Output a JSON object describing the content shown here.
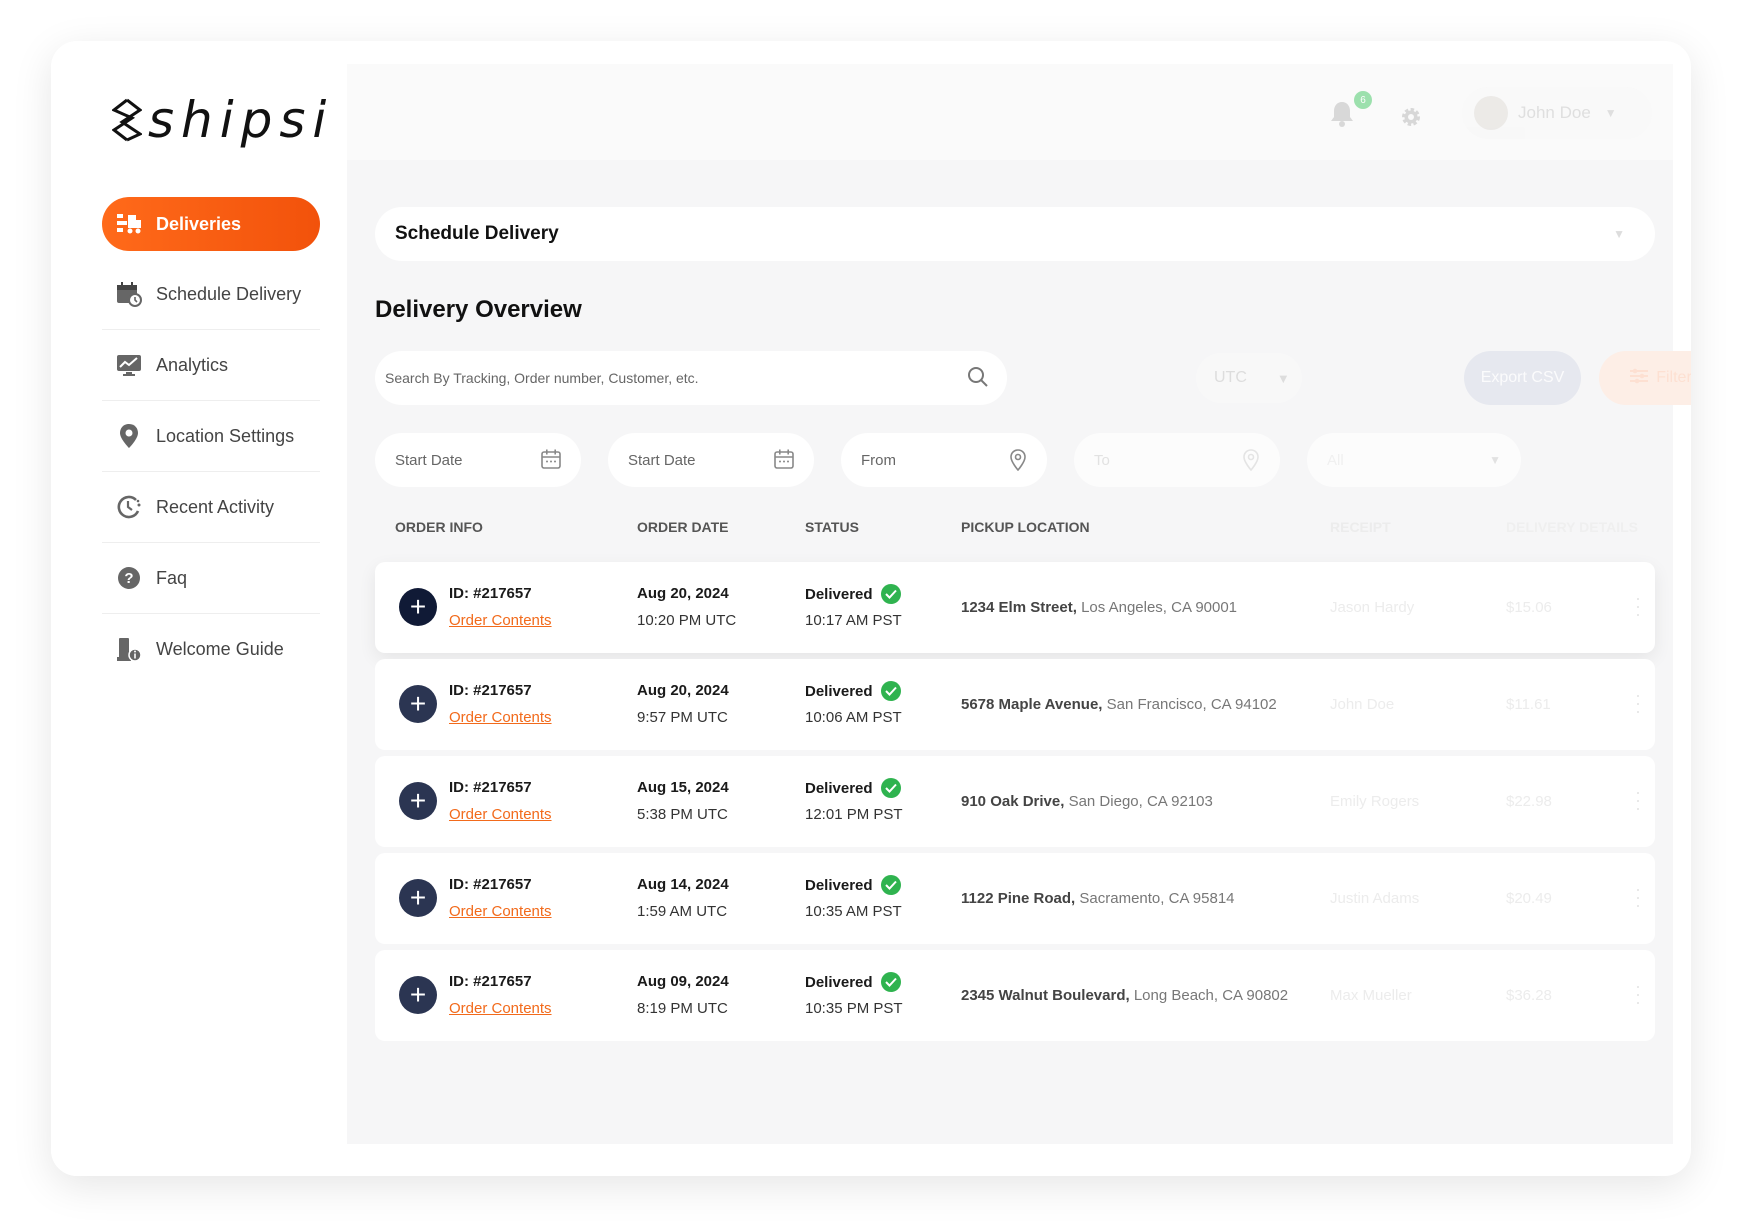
{
  "brand": {
    "name": "shipsi"
  },
  "sidebar": {
    "items": [
      {
        "label": "Deliveries",
        "icon": "deliveries-icon",
        "active": true
      },
      {
        "label": "Schedule Delivery",
        "icon": "calendar-clock-icon"
      },
      {
        "label": "Analytics",
        "icon": "analytics-icon"
      },
      {
        "label": "Location Settings",
        "icon": "location-pin-icon"
      },
      {
        "label": "Recent Activity",
        "icon": "recent-activity-icon"
      },
      {
        "label": "Faq",
        "icon": "help-icon"
      },
      {
        "label": "Welcome Guide",
        "icon": "guide-icon"
      }
    ]
  },
  "topbar": {
    "notification_count": "6",
    "user_name": "John Doe"
  },
  "schedule": {
    "label": "Schedule Delivery"
  },
  "overview": {
    "title": "Delivery Overview",
    "search_placeholder": "Search By Tracking, Order number, Customer, etc.",
    "timezone": "UTC",
    "export_label": "Export CSV",
    "filter_label": "Filter",
    "start_date_1": "Start Date",
    "start_date_2": "Start Date",
    "from": "From",
    "to": "To",
    "all": "All"
  },
  "table": {
    "headers": [
      "ORDER INFO",
      "ORDER DATE",
      "STATUS",
      "PICKUP LOCATION",
      "RECEIPT",
      "DELIVERY DETAILS"
    ],
    "rows": [
      {
        "id": "ID: #217657",
        "contents": "Order Contents",
        "date": "Aug 20, 2024",
        "time": "10:20 PM UTC",
        "status": "Delivered",
        "status_time": "10:17 AM PST",
        "street": "1234 Elm Street,",
        "city": " Los Angeles, CA 90001",
        "receipt": "Jason Hardy",
        "amount": "$15.06"
      },
      {
        "id": "ID: #217657",
        "contents": "Order Contents",
        "date": "Aug 20, 2024",
        "time": "9:57 PM UTC",
        "status": "Delivered",
        "status_time": "10:06 AM PST",
        "street": "5678 Maple Avenue,",
        "city": " San Francisco, CA 94102",
        "receipt": "John Doe",
        "amount": "$11.61"
      },
      {
        "id": "ID: #217657",
        "contents": "Order Contents",
        "date": "Aug 15, 2024",
        "time": "5:38 PM UTC",
        "status": "Delivered",
        "status_time": "12:01 PM PST",
        "street": "910 Oak Drive,",
        "city": " San Diego, CA 92103",
        "receipt": "Emily Rogers",
        "amount": "$22.98"
      },
      {
        "id": "ID: #217657",
        "contents": "Order Contents",
        "date": "Aug 14, 2024",
        "time": "1:59 AM UTC",
        "status": "Delivered",
        "status_time": "10:35 AM PST",
        "street": "1122 Pine Road,",
        "city": " Sacramento, CA 95814",
        "receipt": "Justin Adams",
        "amount": "$20.49"
      },
      {
        "id": "ID: #217657",
        "contents": "Order Contents",
        "date": "Aug 09, 2024",
        "time": "8:19 PM UTC",
        "status": "Delivered",
        "status_time": "10:35 PM PST",
        "street": "2345 Walnut Boulevard,",
        "city": " Long Beach, CA 90802",
        "receipt": "Max Mueller",
        "amount": "$36.28"
      }
    ]
  },
  "colors": {
    "accent": "#f2520b",
    "navy": "#2b3552",
    "success": "#2fb34f"
  }
}
